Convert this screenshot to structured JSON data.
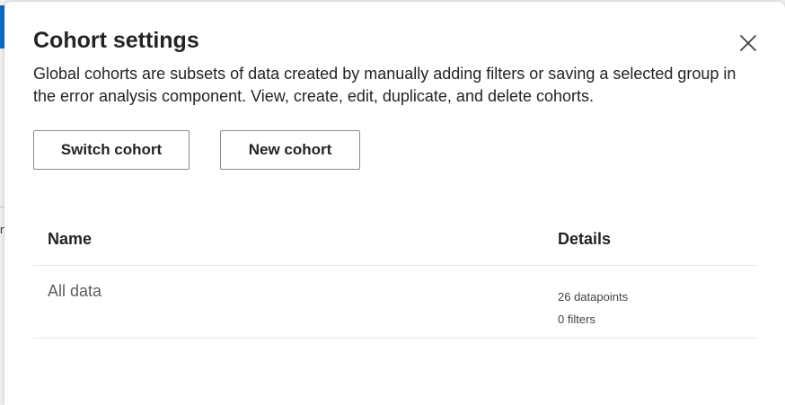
{
  "background": {
    "fragment_text": "n"
  },
  "dialog": {
    "title": "Cohort settings",
    "close_icon": "close-icon",
    "description": "Global cohorts are subsets of data created by manually adding filters or saving a selected group in the error analysis component. View, create, edit, duplicate, and delete cohorts.",
    "buttons": {
      "switch_cohort": "Switch cohort",
      "new_cohort": "New cohort"
    },
    "table": {
      "columns": [
        "Name",
        "Details"
      ],
      "rows": [
        {
          "name": "All data",
          "details": [
            "26 datapoints",
            "0 filters"
          ]
        }
      ]
    }
  },
  "colors": {
    "accent": "#0f6cbd",
    "text": "#242424",
    "muted_text": "#605e5c",
    "border": "#8a8a8a",
    "divider": "#e6e6e6"
  }
}
